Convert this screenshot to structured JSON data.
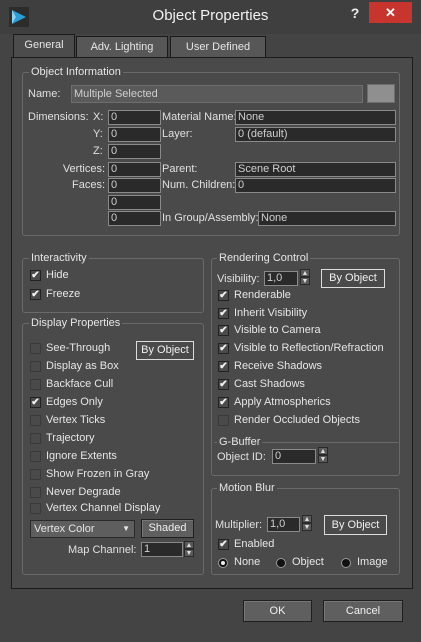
{
  "window": {
    "title": "Object Properties",
    "help": "?",
    "close": "✕"
  },
  "tabs": [
    {
      "label": "General",
      "active": true
    },
    {
      "label": "Adv. Lighting",
      "active": false
    },
    {
      "label": "User Defined",
      "active": false
    }
  ],
  "object_info": {
    "title": "Object Information",
    "name_label": "Name:",
    "name_value": "Multiple Selected",
    "dimensions_label": "Dimensions:",
    "x_label": "X:",
    "x_value": "0",
    "y_label": "Y:",
    "y_value": "0",
    "z_label": "Z:",
    "z_value": "0",
    "vertices_label": "Vertices:",
    "vertices_value": "0",
    "faces_label": "Faces:",
    "faces_value": "0",
    "extra1_value": "0",
    "extra2_value": "0",
    "material_label": "Material Name:",
    "material_value": "None",
    "layer_label": "Layer:",
    "layer_value": "0 (default)",
    "parent_label": "Parent:",
    "parent_value": "Scene Root",
    "children_label": "Num. Children:",
    "children_value": "0",
    "group_label": "In Group/Assembly:",
    "group_value": "None"
  },
  "interactivity": {
    "title": "Interactivity",
    "items": [
      {
        "label": "Hide",
        "checked": true
      },
      {
        "label": "Freeze",
        "checked": true
      }
    ]
  },
  "display": {
    "title": "Display Properties",
    "by_object": "By Object",
    "items": [
      {
        "label": "See-Through",
        "checked": false
      },
      {
        "label": "Display as Box",
        "checked": false
      },
      {
        "label": "Backface Cull",
        "checked": false
      },
      {
        "label": "Edges Only",
        "checked": true
      },
      {
        "label": "Vertex Ticks",
        "checked": false
      },
      {
        "label": "Trajectory",
        "checked": false
      },
      {
        "label": "Ignore Extents",
        "checked": false
      },
      {
        "label": "Show Frozen in Gray",
        "checked": false
      },
      {
        "label": "Never Degrade",
        "checked": false
      },
      {
        "label": "Vertex Channel Display",
        "checked": false
      }
    ],
    "vertex_color": "Vertex Color",
    "shaded": "Shaded",
    "map_channel_label": "Map Channel:",
    "map_channel_value": "1"
  },
  "rendering": {
    "title": "Rendering Control",
    "visibility_label": "Visibility:",
    "visibility_value": "1,0",
    "by_object": "By Object",
    "items": [
      {
        "label": "Renderable",
        "checked": true
      },
      {
        "label": "Inherit Visibility",
        "checked": true
      },
      {
        "label": "Visible to Camera",
        "checked": true
      },
      {
        "label": "Visible to Reflection/Refraction",
        "checked": true
      },
      {
        "label": "Receive Shadows",
        "checked": true
      },
      {
        "label": "Cast Shadows",
        "checked": true
      },
      {
        "label": "Apply Atmospherics",
        "checked": true
      },
      {
        "label": "Render Occluded Objects",
        "checked": false
      }
    ]
  },
  "gbuffer": {
    "title": "G-Buffer",
    "object_id_label": "Object ID:",
    "object_id_value": "0"
  },
  "motion_blur": {
    "title": "Motion Blur",
    "multiplier_label": "Multiplier:",
    "multiplier_value": "1,0",
    "by_object": "By Object",
    "enabled_label": "Enabled",
    "enabled_checked": true,
    "radios": [
      {
        "label": "None",
        "selected": true
      },
      {
        "label": "Object",
        "selected": false
      },
      {
        "label": "Image",
        "selected": false
      }
    ]
  },
  "footer": {
    "ok": "OK",
    "cancel": "Cancel"
  },
  "icons": {
    "app": "3ds-max-logo-icon",
    "check": "✔"
  },
  "colors": {
    "accent": "#c7352e",
    "logo": "#2a9fd6",
    "bg": "#444444"
  }
}
